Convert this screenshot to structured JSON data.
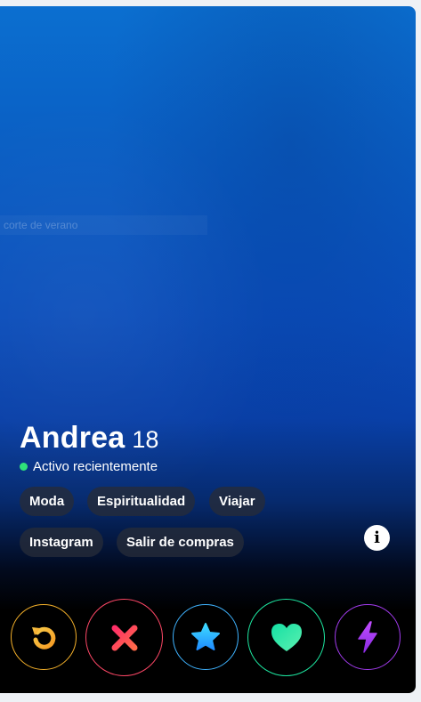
{
  "profile": {
    "name": "Andrea",
    "age": "18",
    "status": "Activo recientemente",
    "watermark_text": "corte de verano"
  },
  "tags": [
    "Moda",
    "Espiritualidad",
    "Viajar",
    "Instagram",
    "Salir de compras"
  ],
  "info_glyph": "i",
  "colors": {
    "active_dot": "#2fe27a",
    "rewind": "#f5b12a",
    "nope": "#fd4766",
    "super_like": "#3fb3ff",
    "like": "#1de6a0",
    "boost": "#a33cf0"
  },
  "actions": [
    {
      "name": "rewind-button",
      "icon": "rewind-icon"
    },
    {
      "name": "nope-button",
      "icon": "close-icon"
    },
    {
      "name": "super-like-button",
      "icon": "star-icon"
    },
    {
      "name": "like-button",
      "icon": "heart-icon"
    },
    {
      "name": "boost-button",
      "icon": "lightning-icon"
    }
  ]
}
